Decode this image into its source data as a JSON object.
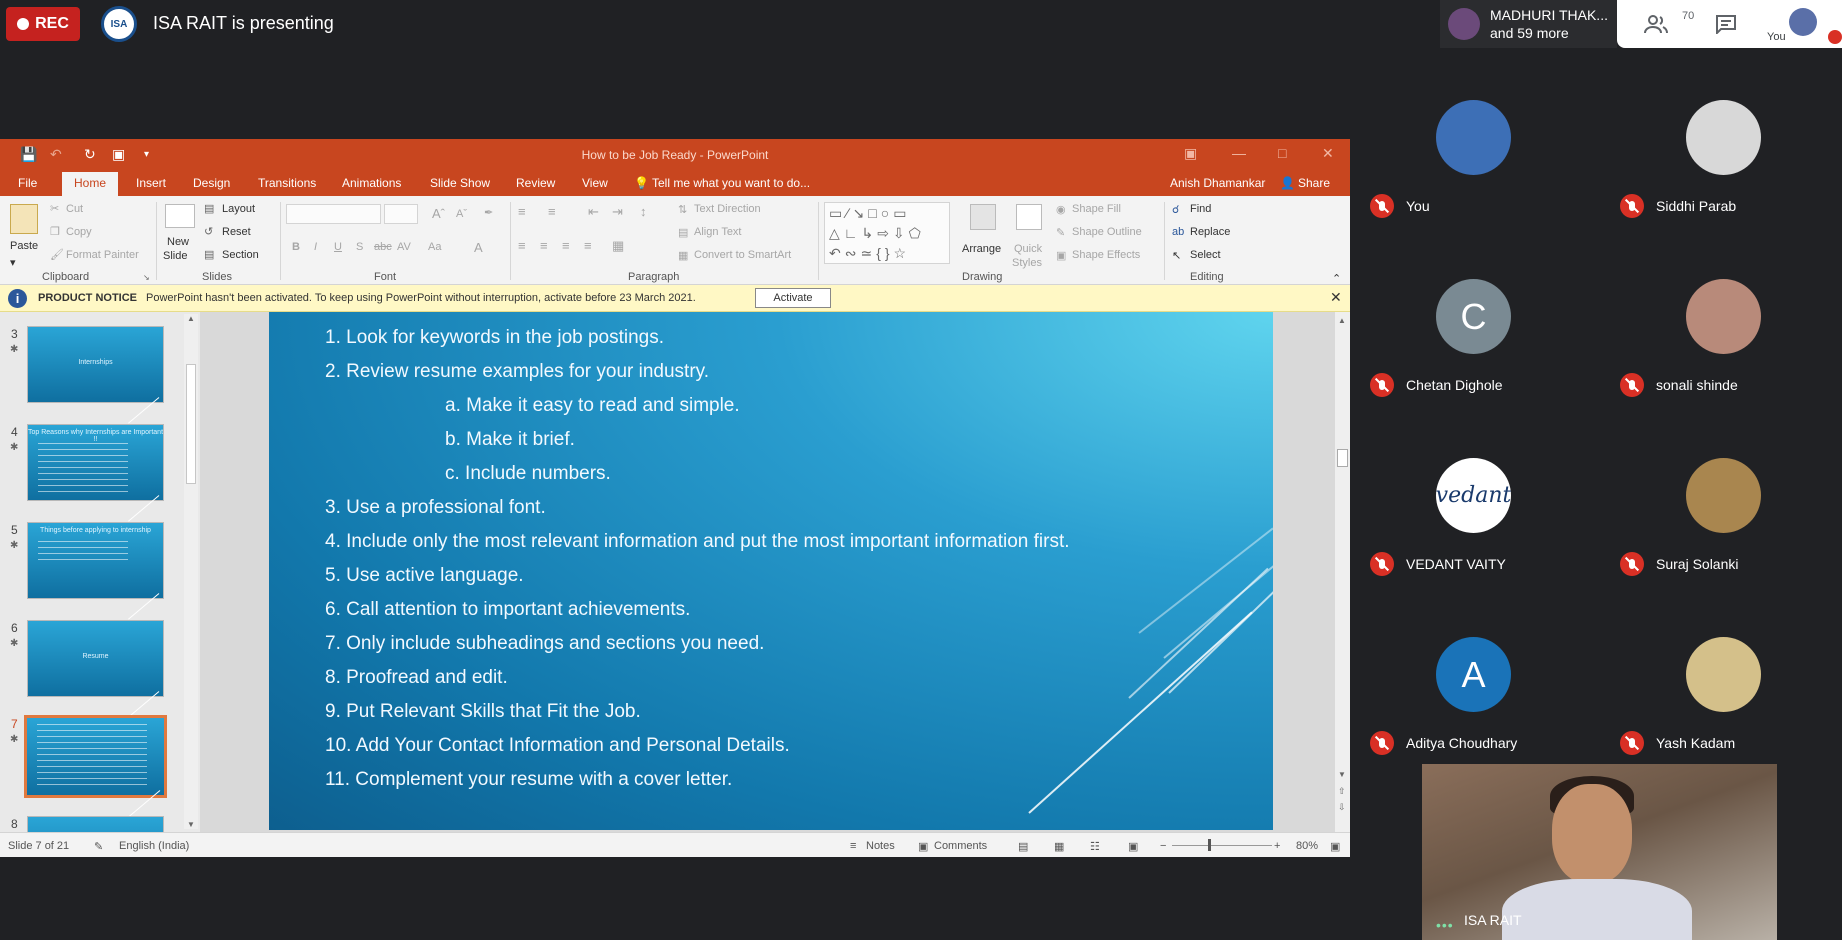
{
  "meeting": {
    "rec_label": "REC",
    "presenter_text": "ISA RAIT is presenting",
    "logo_text": "ISA",
    "chip_name": "MADHURI THAK...",
    "chip_more": "and 59 more",
    "people_count": "70",
    "you_label": "You"
  },
  "ppt": {
    "window_title": "How to be Job Ready - PowerPoint",
    "tabs": [
      "File",
      "Home",
      "Insert",
      "Design",
      "Transitions",
      "Animations",
      "Slide Show",
      "Review",
      "View"
    ],
    "tell_me": "Tell me what you want to do...",
    "user": "Anish Dhamankar",
    "share": "Share",
    "ribbon": {
      "paste": "Paste",
      "cut": "Cut",
      "copy": "Copy",
      "format_painter": "Format Painter",
      "clipboard": "Clipboard",
      "new_slide": "New",
      "new_slide2": "Slide",
      "layout": "Layout",
      "reset": "Reset",
      "section": "Section",
      "slides": "Slides",
      "font": "Font",
      "text_direction": "Text Direction",
      "align_text": "Align Text",
      "convert_smartart": "Convert to SmartArt",
      "paragraph": "Paragraph",
      "arrange": "Arrange",
      "quick": "Quick",
      "styles": "Styles",
      "shape_fill": "Shape Fill",
      "shape_outline": "Shape Outline",
      "shape_effects": "Shape Effects",
      "drawing": "Drawing",
      "find": "Find",
      "replace": "Replace",
      "select": "Select",
      "editing": "Editing"
    },
    "notice": {
      "label": "PRODUCT NOTICE",
      "message": "PowerPoint hasn't been activated. To keep using PowerPoint without interruption, activate before 23 March 2021.",
      "button": "Activate"
    },
    "thumbnails": [
      {
        "num": "3",
        "title": "Internships"
      },
      {
        "num": "4",
        "title": "Top Reasons why Internships are Important !!"
      },
      {
        "num": "5",
        "title": "Things before applying to internship"
      },
      {
        "num": "6",
        "title": "Resume"
      },
      {
        "num": "7",
        "title": ""
      },
      {
        "num": "8",
        "title": ""
      }
    ],
    "slide_lines": [
      "1.  Look for keywords in the job postings.",
      "2.  Review resume examples for your industry.",
      "a. Make it easy to read and simple.",
      "b. Make it brief.",
      "c. Include numbers.",
      "3. Use a professional font.",
      "4. Include only the most relevant information and put the most important information first.",
      "5. Use active language.",
      "6. Call attention to important achievements.",
      "7. Only include subheadings and sections you need.",
      "8. Proofread and edit.",
      "9. Put Relevant Skills that Fit the Job.",
      "10. Add Your Contact Information and Personal Details.",
      "11. Complement your resume with a cover letter."
    ],
    "status": {
      "slide": "Slide 7 of 21",
      "language": "English (India)",
      "notes": "Notes",
      "comments": "Comments",
      "zoom": "80%"
    }
  },
  "participants": [
    {
      "name": "You",
      "initial": "",
      "color": "#3d6fb6"
    },
    {
      "name": "Siddhi Parab",
      "initial": "",
      "color": "#d8d8d8"
    },
    {
      "name": "Chetan Dighole",
      "initial": "C",
      "color": "#7a8a93"
    },
    {
      "name": "sonali shinde",
      "initial": "",
      "color": "#b88a7a"
    },
    {
      "name": "VEDANT VAITY",
      "initial": "vedant",
      "color": "#ffffff"
    },
    {
      "name": "Suraj Solanki",
      "initial": "",
      "color": "#a9864f"
    },
    {
      "name": "Aditya Choudhary",
      "initial": "A",
      "color": "#1a73b8"
    },
    {
      "name": "Yash Kadam",
      "initial": "",
      "color": "#d4c08a"
    }
  ],
  "presenter_tile": {
    "name": "ISA RAIT"
  }
}
